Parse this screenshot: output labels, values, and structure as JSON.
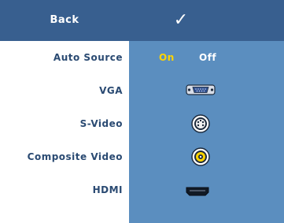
{
  "header": {
    "back_label": "Back",
    "confirm_icon": "checkmark-icon"
  },
  "rows": [
    {
      "label": "Auto Source",
      "options": [
        "On",
        "Off"
      ],
      "selected": "On"
    },
    {
      "label": "VGA",
      "icon": "vga-port-icon"
    },
    {
      "label": "S-Video",
      "icon": "svideo-port-icon"
    },
    {
      "label": "Composite Video",
      "icon": "composite-video-port-icon"
    },
    {
      "label": "HDMI",
      "icon": "hdmi-port-icon"
    }
  ],
  "colors": {
    "header_bg": "#385f8f",
    "panel_bg": "#5b8ebf",
    "label_text": "#2a4a72",
    "selected_option": "#ffd400",
    "unselected_option": "#ffffff"
  }
}
